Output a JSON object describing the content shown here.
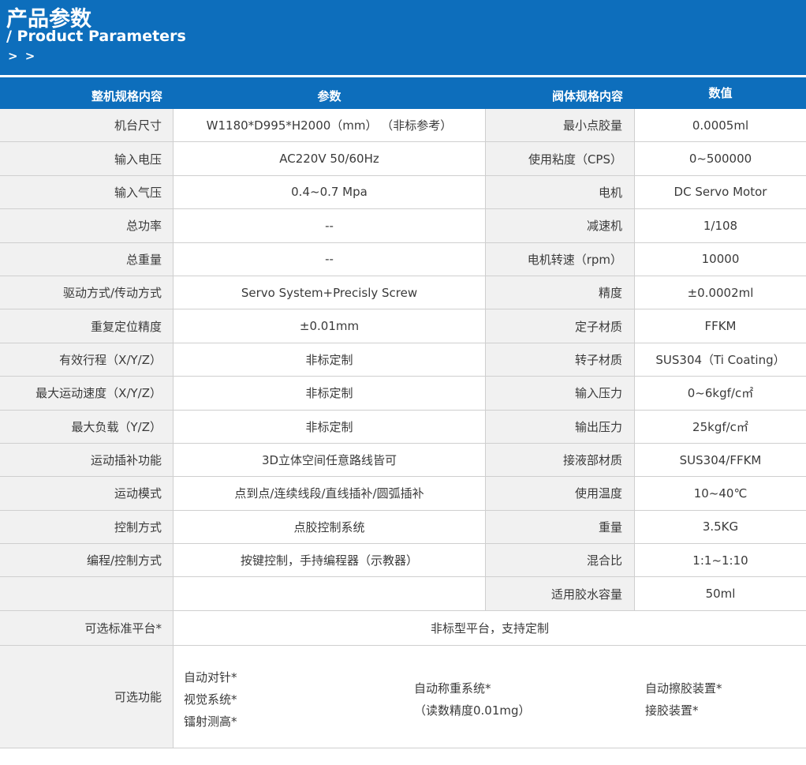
{
  "header": {
    "title_cn": "产品参数",
    "title_en": "/ Product Parameters",
    "arrows": "> >",
    "color": "#0d6ebc"
  },
  "columns": [
    "整机规格内容",
    "参数",
    "阀体规格内容",
    "数值"
  ],
  "rows": [
    {
      "label": "机台尺寸",
      "value": "W1180*D995*H2000（mm） （非标参考）",
      "valve_label": "最小点胶量",
      "valve_value": "0.0005ml"
    },
    {
      "label": "输入电压",
      "value": "AC220V 50/60Hz",
      "valve_label": "使用粘度（CPS）",
      "valve_value": "0~500000"
    },
    {
      "label": "输入气压",
      "value": "0.4~0.7 Mpa",
      "valve_label": "电机",
      "valve_value": "DC Servo Motor"
    },
    {
      "label": "总功率",
      "value": "--",
      "valve_label": "减速机",
      "valve_value": "1/108"
    },
    {
      "label": "总重量",
      "value": "--",
      "valve_label": "电机转速（rpm）",
      "valve_value": "10000"
    },
    {
      "label": "驱动方式/传动方式",
      "value": "Servo System+Precisly  Screw",
      "valve_label": "精度",
      "valve_value": "±0.0002ml"
    },
    {
      "label": "重复定位精度",
      "value": "±0.01mm",
      "valve_label": "定子材质",
      "valve_value": "FFKM"
    },
    {
      "label": "有效行程（X/Y/Z）",
      "value": "非标定制",
      "valve_label": "转子材质",
      "valve_value": "SUS304（Ti Coating）"
    },
    {
      "label": "最大运动速度（X/Y/Z）",
      "value": "非标定制",
      "valve_label": "输入压力",
      "valve_value": "0~6kgf/c㎡"
    },
    {
      "label": "最大负载（Y/Z）",
      "value": "非标定制",
      "valve_label": "输出压力",
      "valve_value": "25kgf/c㎡"
    },
    {
      "label": "运动插补功能",
      "value": "3D立体空间任意路线皆可",
      "valve_label": "接液部材质",
      "valve_value": "SUS304/FFKM"
    },
    {
      "label": "运动模式",
      "value": "点到点/连续线段/直线插补/圆弧插补",
      "valve_label": "使用温度",
      "valve_value": "10~40℃"
    },
    {
      "label": "控制方式",
      "value": "点胶控制系统",
      "valve_label": "重量",
      "valve_value": "3.5KG"
    },
    {
      "label": "编程/控制方式",
      "value": "按键控制，手持编程器（示教器）",
      "valve_label": "混合比",
      "valve_value": "1:1~1:10"
    },
    {
      "label": "",
      "value": "",
      "valve_label": "适用胶水容量",
      "valve_value": "50ml"
    }
  ],
  "platform": {
    "label": "可选标准平台*",
    "value": "非标型平台，支持定制"
  },
  "features": {
    "label": "可选功能",
    "group1": [
      "自动对针*",
      "视觉系统*",
      "镭射测高*"
    ],
    "group2": [
      "自动称重系统*",
      "（读数精度0.01mg）"
    ],
    "group3": [
      "自动擦胶装置*",
      "接胶装置*"
    ]
  }
}
